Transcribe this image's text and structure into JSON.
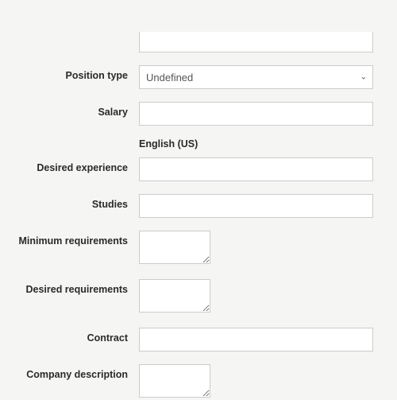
{
  "fields": {
    "position_type": {
      "label": "Position type",
      "value": "Undefined"
    },
    "salary": {
      "label": "Salary",
      "value": ""
    },
    "language_section": "English (US)",
    "desired_experience": {
      "label": "Desired experience",
      "value": ""
    },
    "studies": {
      "label": "Studies",
      "value": ""
    },
    "minimum_requirements": {
      "label": "Minimum requirements",
      "value": ""
    },
    "desired_requirements": {
      "label": "Desired requirements",
      "value": ""
    },
    "contract": {
      "label": "Contract",
      "value": ""
    },
    "company_description": {
      "label": "Company description",
      "value": ""
    }
  }
}
